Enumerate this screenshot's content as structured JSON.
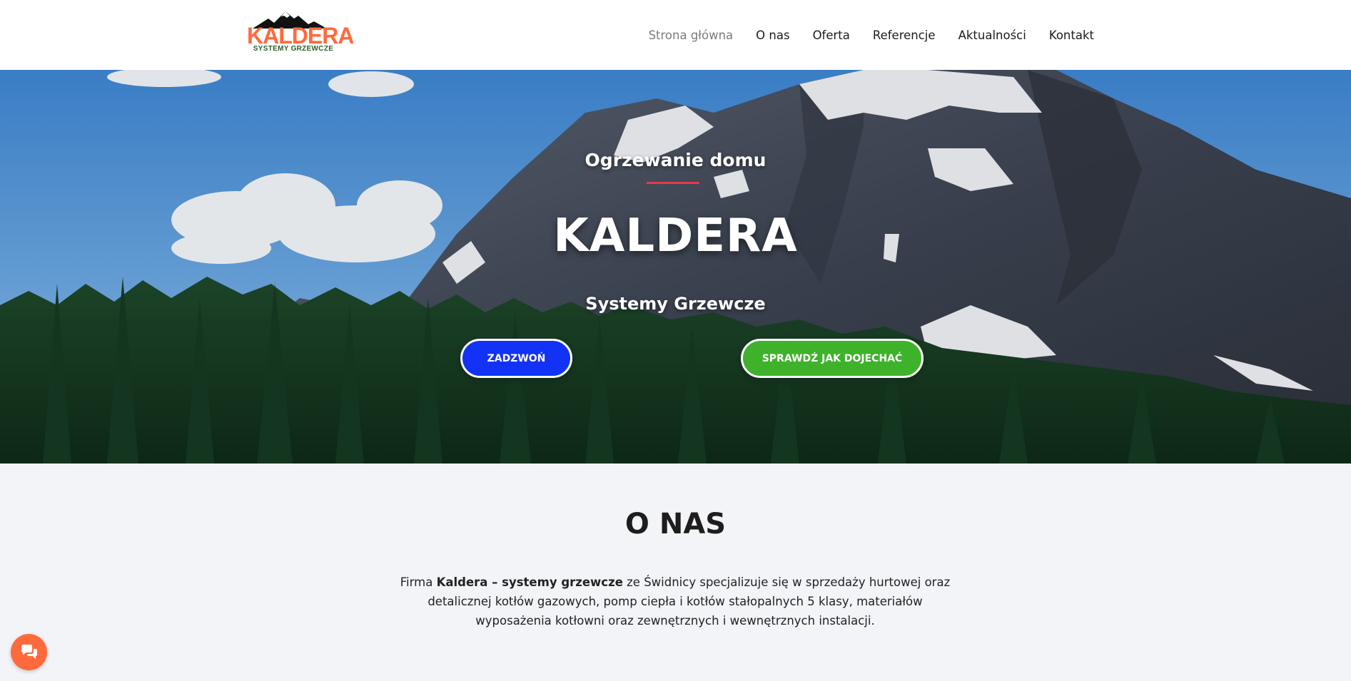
{
  "brand": {
    "logo_title": "KALDERA",
    "logo_subtitle": "SYSTEMY GRZEWCZE",
    "accent_color": "#ff6a3d",
    "subtitle_color": "#2f5d2a"
  },
  "nav": {
    "items": [
      {
        "label": "Strona główna",
        "active": true
      },
      {
        "label": "O nas"
      },
      {
        "label": "Oferta"
      },
      {
        "label": "Referencje"
      },
      {
        "label": "Aktualności"
      },
      {
        "label": "Kontakt"
      }
    ]
  },
  "hero": {
    "kicker": "Ogrzewanie domu",
    "title": "KALDERA",
    "subtitle": "Systemy Grzewcze",
    "call_button": "ZADZWOŃ",
    "map_button": "SPRAWDŹ JAK DOJECHAĆ",
    "call_color": "#1232f5",
    "map_color": "#3db22a",
    "divider_color": "#e6394a"
  },
  "about": {
    "heading": "O NAS",
    "text_prefix": "Firma ",
    "text_bold": "Kaldera – systemy grzewcze",
    "text_rest": " ze Świdnicy specjalizuje się w sprzedaży hurtowej oraz detalicznej kotłów gazowych, pomp ciepła i kotłów stałopalnych 5 klasy, materiałów wyposażenia kotłowni oraz zewnętrznych i wewnętrznych instalacji."
  },
  "chat": {
    "icon": "chat-bubbles-icon"
  }
}
